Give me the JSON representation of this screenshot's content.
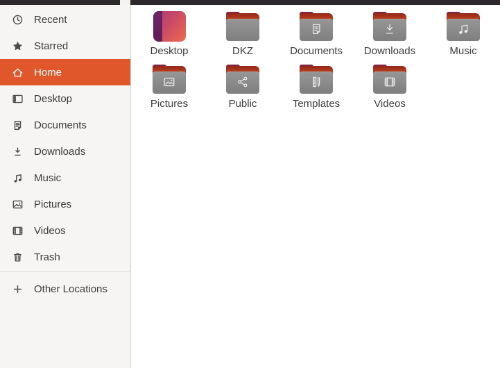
{
  "sidebar": {
    "items": [
      {
        "label": "Recent",
        "icon": "clock",
        "selected": false
      },
      {
        "label": "Starred",
        "icon": "star",
        "selected": false
      },
      {
        "label": "Home",
        "icon": "home",
        "selected": true
      },
      {
        "label": "Desktop",
        "icon": "desktop",
        "selected": false
      },
      {
        "label": "Documents",
        "icon": "document",
        "selected": false
      },
      {
        "label": "Downloads",
        "icon": "download",
        "selected": false
      },
      {
        "label": "Music",
        "icon": "music",
        "selected": false
      },
      {
        "label": "Pictures",
        "icon": "image",
        "selected": false
      },
      {
        "label": "Videos",
        "icon": "film",
        "selected": false
      },
      {
        "label": "Trash",
        "icon": "trash",
        "selected": false
      }
    ],
    "other_locations": {
      "label": "Other Locations",
      "icon": "plus"
    }
  },
  "files": [
    {
      "name": "Desktop",
      "icon": "desktop-wallpaper",
      "emblem": "none"
    },
    {
      "name": "DKZ",
      "icon": "folder",
      "emblem": "none"
    },
    {
      "name": "Documents",
      "icon": "folder",
      "emblem": "document"
    },
    {
      "name": "Downloads",
      "icon": "folder",
      "emblem": "download"
    },
    {
      "name": "Music",
      "icon": "folder",
      "emblem": "music"
    },
    {
      "name": "Pictures",
      "icon": "folder",
      "emblem": "image"
    },
    {
      "name": "Public",
      "icon": "folder",
      "emblem": "share"
    },
    {
      "name": "Templates",
      "icon": "folder",
      "emblem": "template"
    },
    {
      "name": "Videos",
      "icon": "folder",
      "emblem": "film"
    }
  ],
  "colors": {
    "accent_orange": "#e0572c",
    "topbar": "#2c282c",
    "sidebar_bg": "#f6f5f4",
    "folder_front": "#8a8a8a",
    "folder_back_orange": "#f3743e",
    "folder_tab_maroon": "#7e2342",
    "desktop_purple": "#6f2367"
  }
}
